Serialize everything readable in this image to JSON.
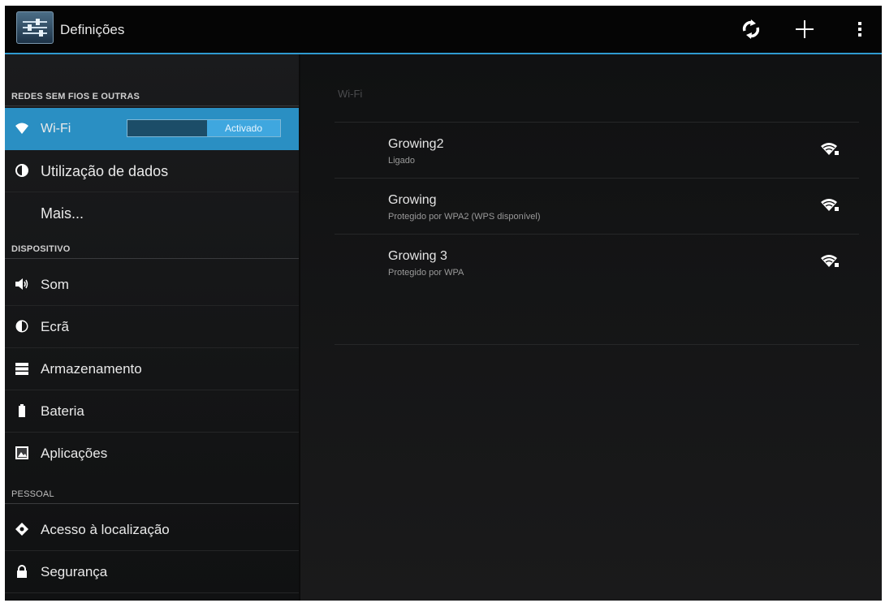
{
  "actionbar": {
    "title": "Definições",
    "actions": [
      {
        "icon": "wps-refresh-icon"
      },
      {
        "icon": "add-icon"
      },
      {
        "icon": "overflow-menu-icon"
      }
    ]
  },
  "sidebar": {
    "categories": [
      "REDES SEM FIOS E OUTRAS",
      "DISPOSITIVO",
      "PESSOAL"
    ],
    "items": [
      {
        "label": "Wi-Fi",
        "icon": "wifi-icon",
        "selected": true,
        "switch": "Activado"
      },
      {
        "label": "Utilização de dados",
        "icon": "data-usage-icon"
      },
      {
        "label": "Mais...",
        "icon": ""
      },
      {
        "label": "Som",
        "icon": "volume-icon"
      },
      {
        "label": "Ecrã",
        "icon": "display-icon"
      },
      {
        "label": "Armazenamento",
        "icon": "storage-icon"
      },
      {
        "label": "Bateria",
        "icon": "battery-icon"
      },
      {
        "label": "Aplicações",
        "icon": "apps-icon"
      },
      {
        "label": "Acesso à localização",
        "icon": "location-icon"
      },
      {
        "label": "Segurança",
        "icon": "lock-icon"
      }
    ]
  },
  "detail": {
    "title": "Wi-Fi",
    "networks": [
      {
        "ssid": "Growing2",
        "status": "Ligado",
        "signal_icon": "wifi-signal-locked-icon"
      },
      {
        "ssid": "Growing",
        "status": "Protegido por WPA2 (WPS disponível)",
        "signal_icon": "wifi-signal-locked-icon"
      },
      {
        "ssid": "Growing 3",
        "status": "Protegido por WPA",
        "signal_icon": "wifi-signal-locked-icon"
      }
    ]
  },
  "colors": {
    "accent": "#2a8fc3",
    "actionbar_divider": "#2f9ad0",
    "background": "#0c0c0c"
  }
}
